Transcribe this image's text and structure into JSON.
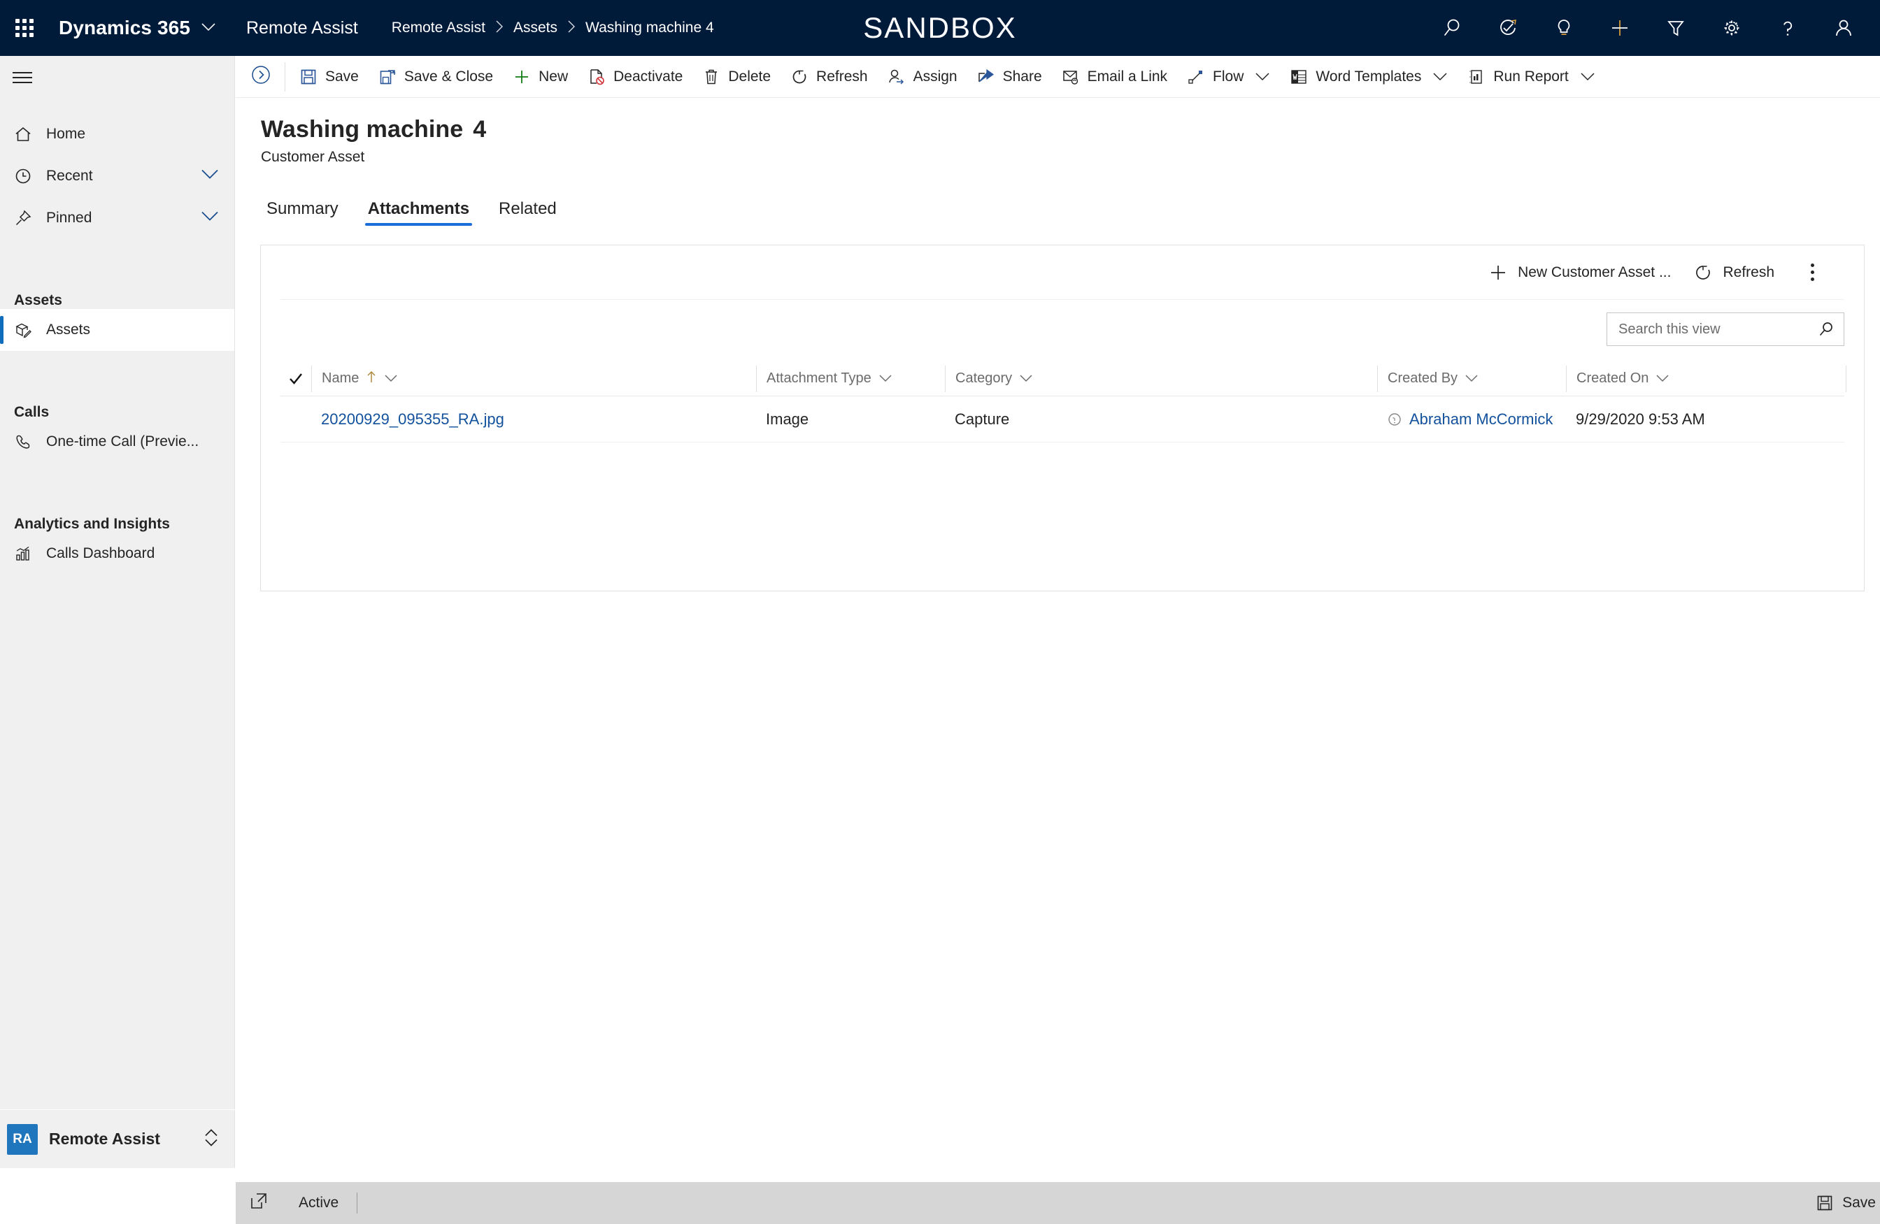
{
  "topbar": {
    "waffle_label": "App launcher",
    "brand": "Dynamics 365",
    "app_name": "Remote Assist",
    "sandbox_label": "SANDBOX",
    "breadcrumb": [
      {
        "label": "Remote Assist"
      },
      {
        "label": "Assets"
      },
      {
        "label": "Washing machine 4"
      }
    ],
    "icons": [
      {
        "name": "search-icon"
      },
      {
        "name": "relationship-assistant-icon"
      },
      {
        "name": "lightbulb-icon"
      },
      {
        "name": "quick-create-icon"
      },
      {
        "name": "filter-icon"
      },
      {
        "name": "settings-gear-icon"
      },
      {
        "name": "help-icon"
      },
      {
        "name": "user-avatar-icon"
      }
    ]
  },
  "sidebar": {
    "hamburger_label": "Expand navigation",
    "items": [
      {
        "label": "Home",
        "icon": "home-icon"
      },
      {
        "label": "Recent",
        "icon": "clock-icon",
        "chevron": true
      },
      {
        "label": "Pinned",
        "icon": "pin-icon",
        "chevron": true
      }
    ],
    "groups": [
      {
        "title": "Assets",
        "items": [
          {
            "label": "Assets",
            "icon": "asset-box-icon",
            "selected": true
          }
        ]
      },
      {
        "title": "Calls",
        "items": [
          {
            "label": "One-time Call (Previe...",
            "icon": "phone-icon",
            "selected": false
          }
        ]
      },
      {
        "title": "Analytics and Insights",
        "items": [
          {
            "label": "Calls Dashboard",
            "icon": "chart-icon",
            "selected": false
          }
        ]
      }
    ],
    "footer": {
      "badge": "RA",
      "label": "Remote Assist"
    }
  },
  "commandbar": {
    "expand_label": "Expand command bar",
    "commands": [
      {
        "label": "Save",
        "icon": "save-icon"
      },
      {
        "label": "Save & Close",
        "icon": "save-close-icon"
      },
      {
        "label": "New",
        "icon": "plus-icon"
      },
      {
        "label": "Deactivate",
        "icon": "deactivate-icon"
      },
      {
        "label": "Delete",
        "icon": "trash-icon"
      },
      {
        "label": "Refresh",
        "icon": "refresh-icon"
      },
      {
        "label": "Assign",
        "icon": "assign-icon"
      },
      {
        "label": "Share",
        "icon": "share-icon"
      },
      {
        "label": "Email a Link",
        "icon": "email-link-icon"
      },
      {
        "label": "Flow",
        "icon": "flow-icon",
        "caret": true
      },
      {
        "label": "Word Templates",
        "icon": "word-templates-icon",
        "caret": true
      },
      {
        "label": "Run Report",
        "icon": "run-report-icon",
        "caret": true
      }
    ]
  },
  "page": {
    "title": "Washing machine",
    "title_number": "4",
    "subtitle": "Customer Asset",
    "tabs": [
      {
        "label": "Summary",
        "active": false
      },
      {
        "label": "Attachments",
        "active": true
      },
      {
        "label": "Related",
        "active": false
      }
    ]
  },
  "subgrid": {
    "toolbar": [
      {
        "label": "New Customer Asset ...",
        "icon": "plus-icon"
      },
      {
        "label": "Refresh",
        "icon": "refresh-icon"
      }
    ],
    "kebab_label": "More commands",
    "search": {
      "placeholder": "Search this view",
      "value": "",
      "icon": "search-icon"
    },
    "columns": [
      {
        "label": "Name",
        "sorted": "asc"
      },
      {
        "label": "Attachment Type",
        "sorted": ""
      },
      {
        "label": "Category",
        "sorted": ""
      },
      {
        "label": "Created By",
        "sorted": ""
      },
      {
        "label": "Created On",
        "sorted": ""
      }
    ],
    "rows": [
      {
        "name": "20200929_095355_RA.jpg",
        "attachment_type": "Image",
        "category": "Capture",
        "created_by": "Abraham McCormick",
        "created_on": "9/29/2020 9:53 AM"
      }
    ]
  },
  "statusbar": {
    "popout_label": "Open in new window",
    "state": "Active",
    "save_label": "Save"
  },
  "colors": {
    "nav_background": "#001b3a",
    "accent_blue": "#1a6ed8",
    "link_blue": "#13519c",
    "selected_bar": "#0f6cbd",
    "sidebar_background": "#f0f0f0",
    "statusbar_background": "#d6d6d6",
    "save_icon_blue": "#2b579a",
    "new_icon_green": "#107c10",
    "deactivate_red": "#d13438"
  }
}
